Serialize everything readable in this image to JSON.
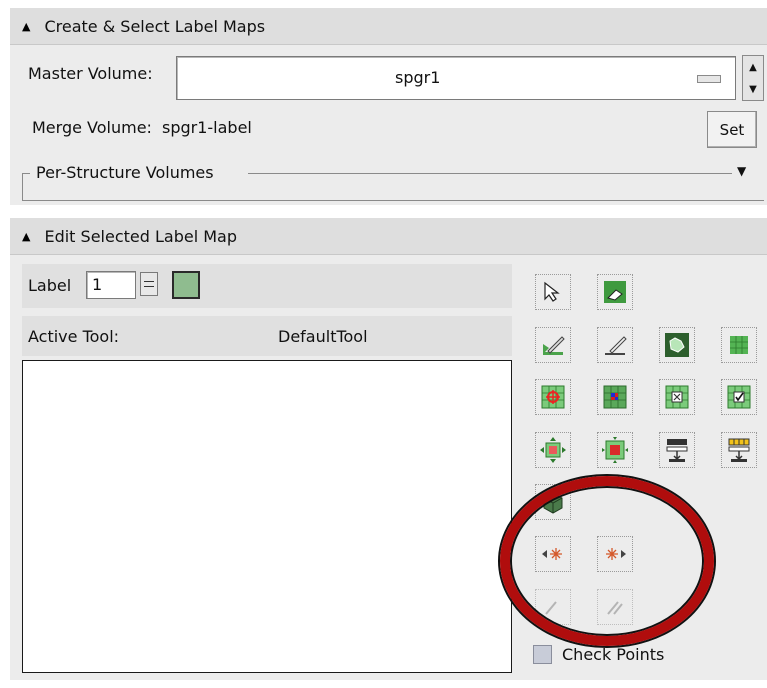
{
  "create_section": {
    "title": "Create & Select Label Maps",
    "master_volume_label": "Master Volume:",
    "master_volume_value": "spgr1",
    "merge_volume_label": "Merge Volume:",
    "merge_volume_value": "spgr1-label",
    "set_button": "Set",
    "per_structure_label": "Per-Structure Volumes"
  },
  "edit_section": {
    "title": "Edit Selected Label Map",
    "label_caption": "Label",
    "label_value": "1",
    "label_color": "#8fbc8f",
    "active_tool_label": "Active Tool:",
    "active_tool_value": "DefaultTool",
    "check_points_label": "Check Points"
  },
  "icons": [
    "select-arrow-icon",
    "erase-label-icon",
    "draw-icon",
    "draw-erase-icon",
    "change-island-icon",
    "fill-grid-icon",
    "threshold-icon",
    "change-label-icon",
    "remove-islands-icon",
    "identify-islands-icon",
    "dilate-icon",
    "erode-icon",
    "save-island-icon",
    "paint-icon",
    "cube-icon",
    "previous-slice-icon",
    "next-slice-icon",
    "undo-icon",
    "redo-icon"
  ],
  "colors": {
    "header_bg": "#dedede",
    "panel_bg": "#ececec",
    "annotation_red": "#b00d0d"
  }
}
